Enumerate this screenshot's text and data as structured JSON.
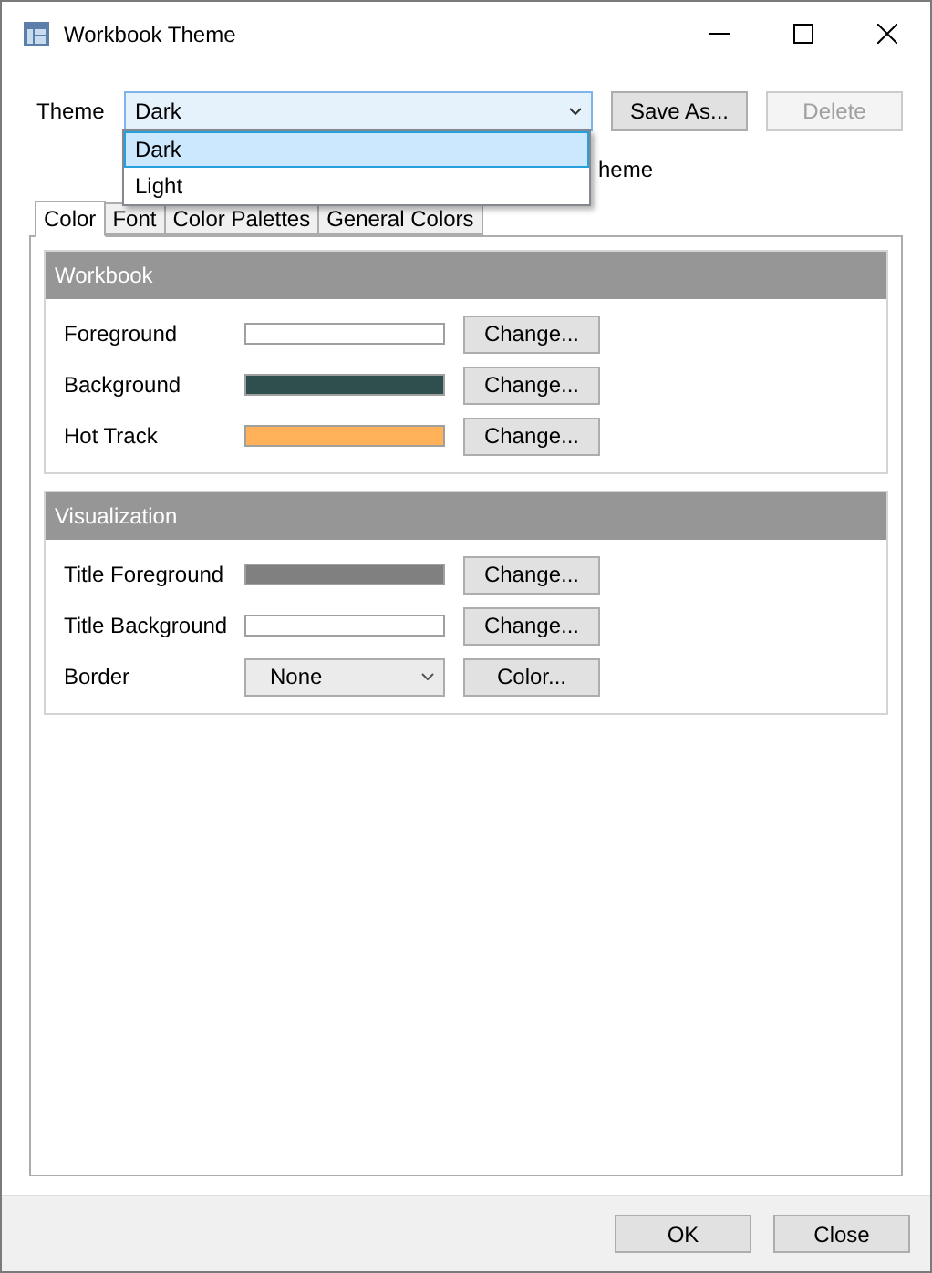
{
  "window": {
    "title": "Workbook Theme"
  },
  "theme": {
    "label": "Theme",
    "value": "Dark",
    "options": [
      {
        "label": "Dark",
        "selected": true
      },
      {
        "label": "Light",
        "selected": false
      }
    ],
    "buttons": [
      {
        "label": "Save As...",
        "disabled": false
      },
      {
        "label": "Delete",
        "disabled": true
      }
    ]
  },
  "covered_text": "heme",
  "tabs": [
    {
      "label": "Color",
      "selected": true
    },
    {
      "label": "Font",
      "selected": false
    },
    {
      "label": "Color Palettes",
      "selected": false
    },
    {
      "label": "General Colors",
      "selected": false
    }
  ],
  "sections": [
    {
      "title": "Workbook",
      "rows": [
        {
          "kind": "swatch",
          "label": "Foreground",
          "color": "#ffffff",
          "button": "Change..."
        },
        {
          "kind": "swatch",
          "label": "Background",
          "color": "#2f4f4f",
          "button": "Change..."
        },
        {
          "kind": "swatch",
          "label": "Hot Track",
          "color": "#ffb25a",
          "button": "Change..."
        }
      ]
    },
    {
      "title": "Visualization",
      "rows": [
        {
          "kind": "swatch",
          "label": "Title Foreground",
          "color": "#808080",
          "button": "Change..."
        },
        {
          "kind": "swatch",
          "label": "Title Background",
          "color": "#ffffff",
          "button": "Change..."
        },
        {
          "kind": "select",
          "label": "Border",
          "value": "None",
          "button": "Color..."
        }
      ]
    }
  ],
  "footer": {
    "buttons": [
      "OK",
      "Close"
    ]
  }
}
